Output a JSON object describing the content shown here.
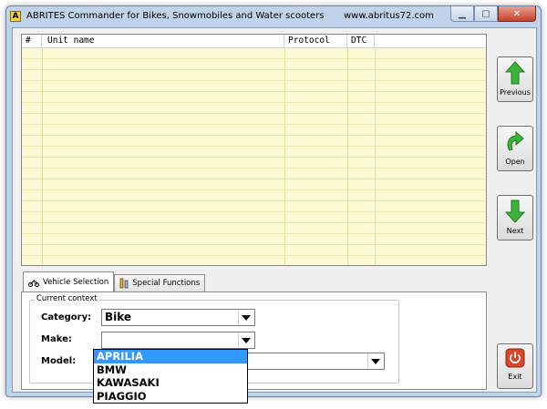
{
  "window": {
    "title": "ABRITES Commander for Bikes, Snowmobiles and Water scooters",
    "url": "www.abritus72.com",
    "icon_letter": "A"
  },
  "grid": {
    "columns": [
      "#",
      "Unit name",
      "Protocol",
      "DTC"
    ],
    "rows": []
  },
  "side_buttons": {
    "previous": "Previous",
    "open": "Open",
    "next": "Next",
    "exit": "Exit"
  },
  "tabs": [
    {
      "label": "Vehicle Selection",
      "icon": "motorbike-icon",
      "active": true
    },
    {
      "label": "Special Functions",
      "icon": "tools-icon",
      "active": false
    }
  ],
  "context": {
    "legend": "Current context",
    "category_label": "Category:",
    "category_value": "Bike",
    "make_label": "Make:",
    "make_value": "",
    "model_label": "Model:",
    "model_value": ""
  },
  "make_dropdown": {
    "options": [
      "APRILIA",
      "BMW",
      "KAWASAKI",
      "PIAGGIO"
    ],
    "highlighted": "APRILIA"
  },
  "colors": {
    "grid_bg": "#fdfbd5",
    "highlight": "#3399ff",
    "arrow_green": "#3cb43c",
    "exit_red": "#d9462a"
  }
}
